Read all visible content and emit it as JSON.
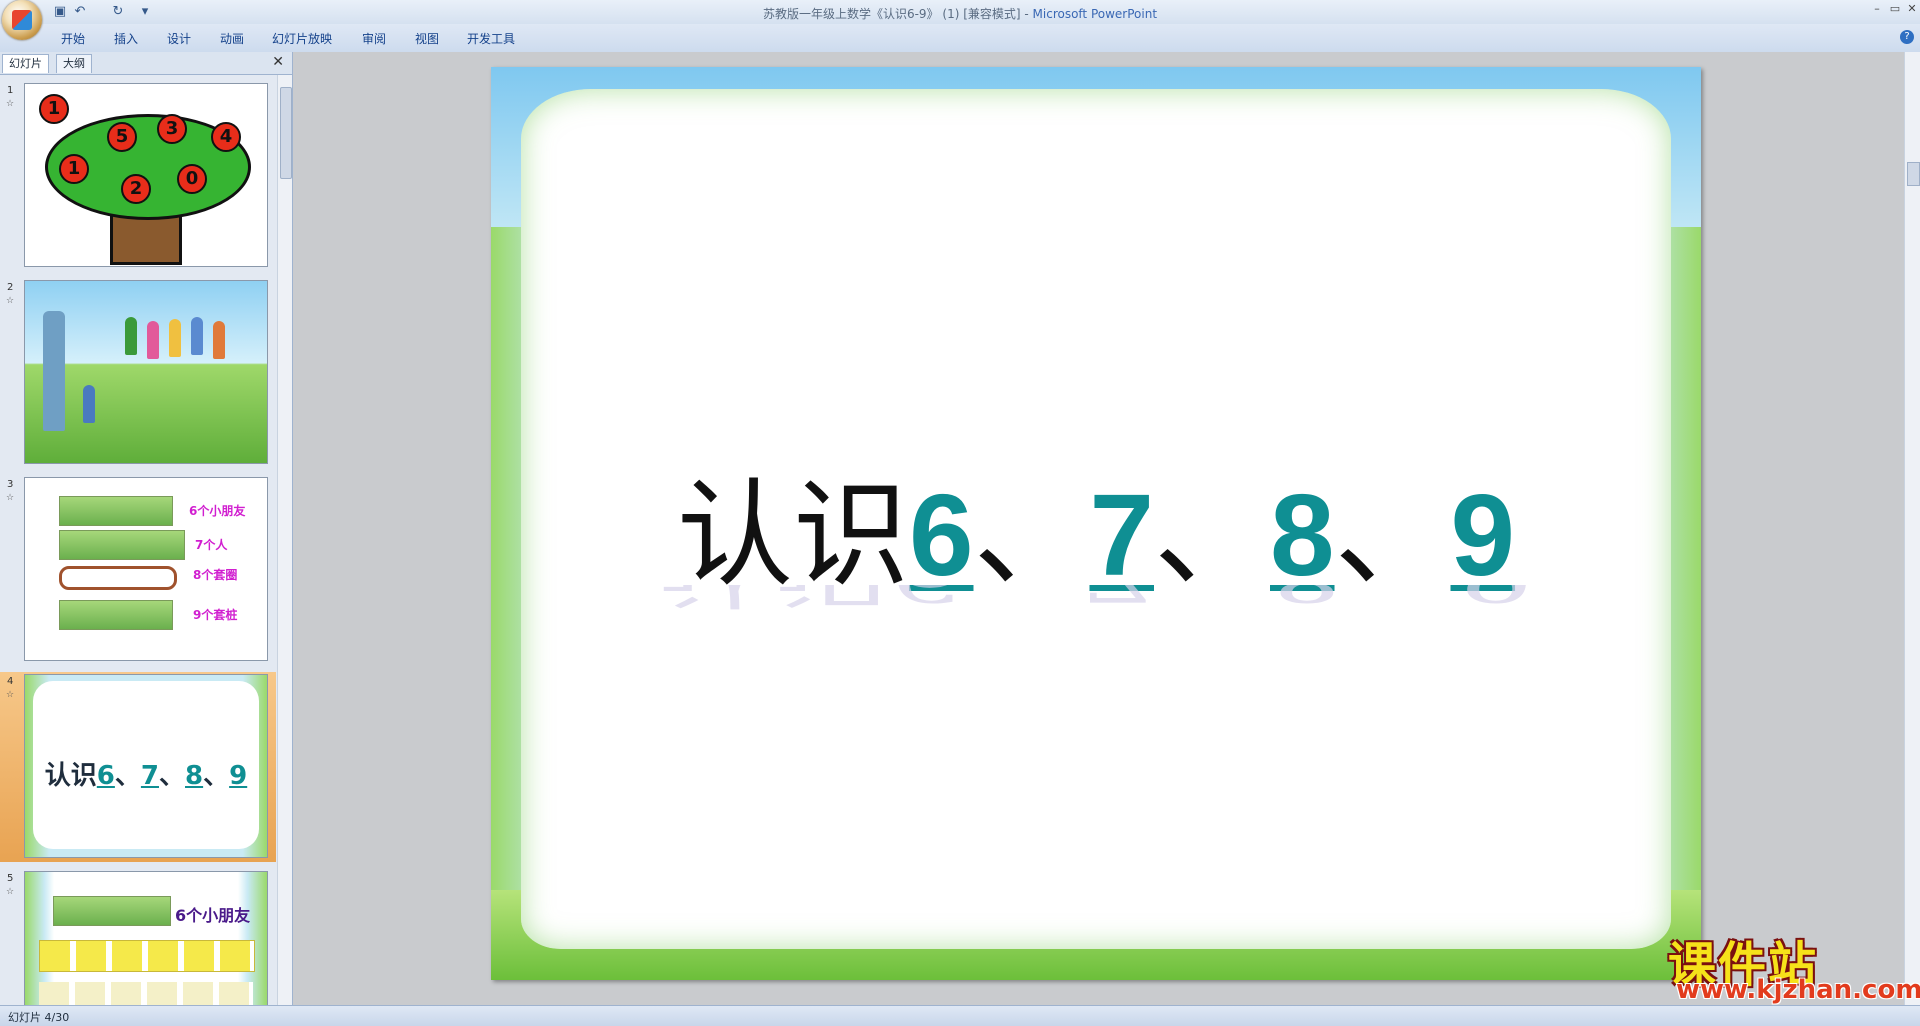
{
  "window": {
    "title_doc": "苏教版一年级上数学《认识6-9》 (1) [兼容模式] - ",
    "title_app": "Microsoft PowerPoint",
    "controls": {
      "minimize": "–",
      "maximize": "▭",
      "close": "✕"
    }
  },
  "quick_access": {
    "icons": [
      "save-icon",
      "undo-icon",
      "redo-icon",
      "customize-icon"
    ],
    "glyphs": {
      "save": "▣",
      "undo": "↶",
      "redo": "↻",
      "customize": "▾"
    }
  },
  "ribbon": {
    "tabs": [
      "开始",
      "插入",
      "设计",
      "动画",
      "幻灯片放映",
      "审阅",
      "视图",
      "开发工具"
    ],
    "help": "?"
  },
  "panel": {
    "tabs": [
      "幻灯片",
      "大纲"
    ],
    "close": "✕"
  },
  "thumbnails": [
    {
      "number": "1",
      "marker": "☆",
      "apples": [
        "1",
        "5",
        "3",
        "4",
        "1",
        "2",
        "0"
      ]
    },
    {
      "number": "2",
      "marker": "☆"
    },
    {
      "number": "3",
      "marker": "☆",
      "labels": [
        "6个小朋友",
        "7个人",
        "8个套圈",
        "9个套桩"
      ]
    },
    {
      "number": "4",
      "marker": "☆",
      "title_prefix": "认识",
      "numbers": [
        "6",
        "7",
        "8",
        "9"
      ],
      "separator": "、",
      "selected": true
    },
    {
      "number": "5",
      "marker": "☆",
      "label": "6个小朋友"
    }
  ],
  "slide": {
    "title_prefix": "认识",
    "numbers": [
      "6",
      "7",
      "8",
      "9"
    ],
    "separator": "、",
    "colors": {
      "number": "#0f8f93",
      "text": "#111111"
    }
  },
  "watermark": {
    "text_cn": "课件站",
    "url": "www.kjzhan.com"
  },
  "status": {
    "slide_indicator": "幻灯片 4/30"
  }
}
